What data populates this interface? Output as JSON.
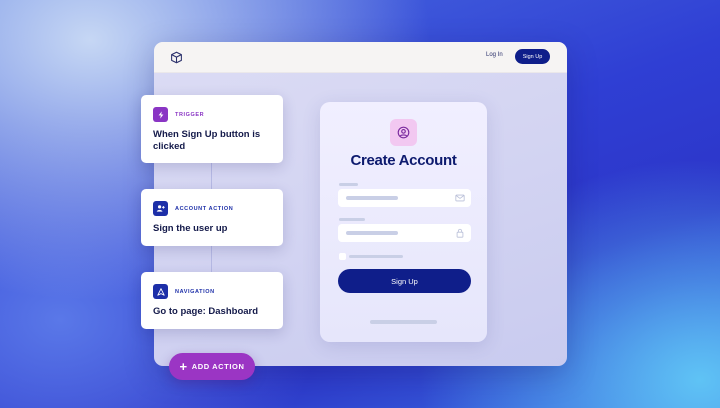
{
  "header": {
    "login_label": "Log In",
    "signup_label": "Sign Up",
    "logo_icon": "box-icon"
  },
  "form": {
    "title": "Create Account",
    "submit_label": "Sign Up",
    "avatar_icon": "user-circle-icon",
    "email_icon": "envelope-icon",
    "password_icon": "lock-icon"
  },
  "steps": [
    {
      "kind": "TRIGGER",
      "title": "When Sign Up button is clicked",
      "icon": "lightning-icon",
      "color": "#8a35c4"
    },
    {
      "kind": "ACCOUNT ACTION",
      "title": "Sign the user up",
      "icon": "user-add-icon",
      "color": "#1d2fa8"
    },
    {
      "kind": "NAVIGATION",
      "title": "Go to page: Dashboard",
      "icon": "navigation-icon",
      "color": "#1d2fa8"
    }
  ],
  "add_action": {
    "label": "ADD ACTION"
  },
  "colors": {
    "brand_navy": "#0f1e8a",
    "accent_purple": "#9b35c4",
    "trigger_purple": "#8a35c4",
    "action_blue": "#1d2fa8"
  }
}
